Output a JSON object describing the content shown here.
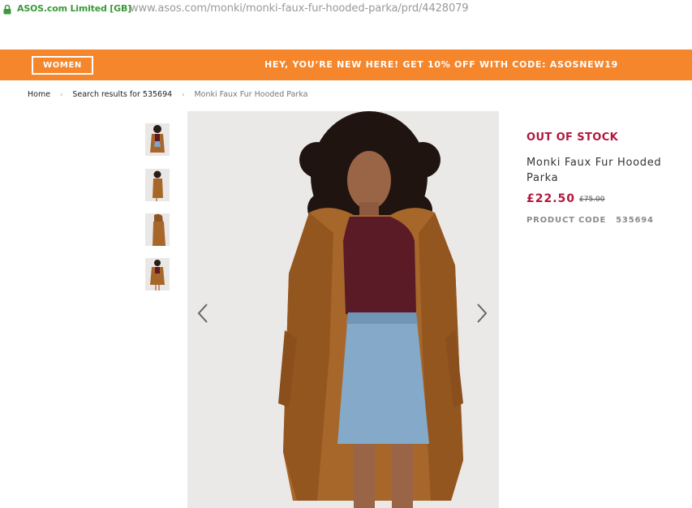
{
  "browser": {
    "certificate": "ASOS.com Limited [GB]",
    "url": "www.asos.com/monki/monki-faux-fur-hooded-parka/prd/4428079",
    "lock_icon": "padlock-icon"
  },
  "promo_bar": {
    "women_label": "WOMEN",
    "message": "HEY, YOU’RE NEW HERE! GET 10% OFF WITH CODE: ASOSNEW19",
    "color": "#f5862c"
  },
  "breadcrumb": {
    "items": [
      "Home",
      "Search results for 535694",
      "Monki Faux Fur Hooded Parka"
    ],
    "separator": "›"
  },
  "gallery": {
    "thumbnails": [
      "front view",
      "side view",
      "back view",
      "detail view"
    ],
    "prev_icon": "chevron-left-icon",
    "next_icon": "chevron-right-icon"
  },
  "product": {
    "status": "OUT OF STOCK",
    "name": "Monki Faux Fur Hooded Parka",
    "price": "£22.50",
    "was_price": "£75.00",
    "code_label": "PRODUCT CODE",
    "code_value": "535694",
    "accent_color": "#b3173c"
  }
}
